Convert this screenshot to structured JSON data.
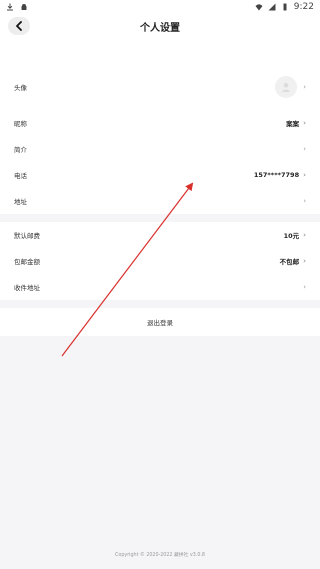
{
  "status_bar": {
    "time": "9:22"
  },
  "header": {
    "title": "个人设置"
  },
  "profile_group": {
    "avatar_label": "头像",
    "nickname_label": "昵称",
    "nickname_value": "案案",
    "intro_label": "简介",
    "phone_label": "电话",
    "phone_value": "157****7798",
    "address_label": "地址"
  },
  "shipping_group": {
    "default_postage_label": "默认邮费",
    "default_postage_value": "10元",
    "free_shipping_label": "包邮金额",
    "free_shipping_value": "不包邮",
    "receive_address_label": "收件地址"
  },
  "logout_label": "退出登录",
  "footer": {
    "copyright": "Copyright © 2020-2022 藏拼社 v3.0.8"
  },
  "colors": {
    "annotation_arrow": "#d9302c",
    "background": "#f5f5f7"
  }
}
